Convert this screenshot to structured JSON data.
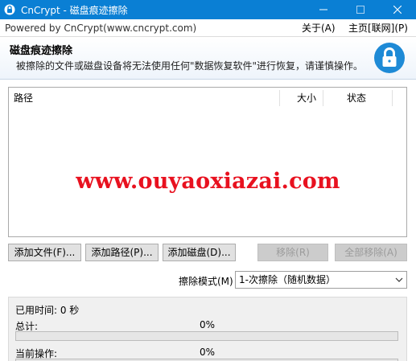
{
  "window": {
    "title": "CnCrypt - 磁盘痕迹擦除",
    "controls": [
      "minimize-icon",
      "maximize-icon",
      "close-icon"
    ]
  },
  "menubar": {
    "powered_by": "Powered by CnCrypt(www.cncrypt.com)",
    "about": "关于(A)",
    "homepage": "主页[联网](P)"
  },
  "banner": {
    "heading": "磁盘痕迹擦除",
    "description": "被擦除的文件或磁盘设备将无法使用任何\"数据恢复软件\"进行恢复，请谨慎操作。",
    "icon": "lock-icon"
  },
  "list": {
    "columns": [
      "路径",
      "大小",
      "状态"
    ],
    "rows": []
  },
  "watermark": "www.ouyaoxiazai.com",
  "buttons": {
    "add_file": "添加文件(F)...",
    "add_path": "添加路径(P)...",
    "add_disk": "添加磁盘(D)...",
    "remove": "移除(R)",
    "remove_all": "全部移除(A)"
  },
  "wipe_mode": {
    "label": "擦除模式(M)",
    "selected": "1-次擦除（随机数据）"
  },
  "status": {
    "elapsed_label": "已用时间: 0 秒",
    "total_label": "总计:",
    "total_percent": "0%",
    "total_progress": 0,
    "current_label": "当前操作:",
    "current_percent": "0%",
    "current_progress": 0
  },
  "colors": {
    "titlebar": "#0a7fd4",
    "watermark": "#e8111f",
    "lock_icon": "#1e8ad6"
  }
}
